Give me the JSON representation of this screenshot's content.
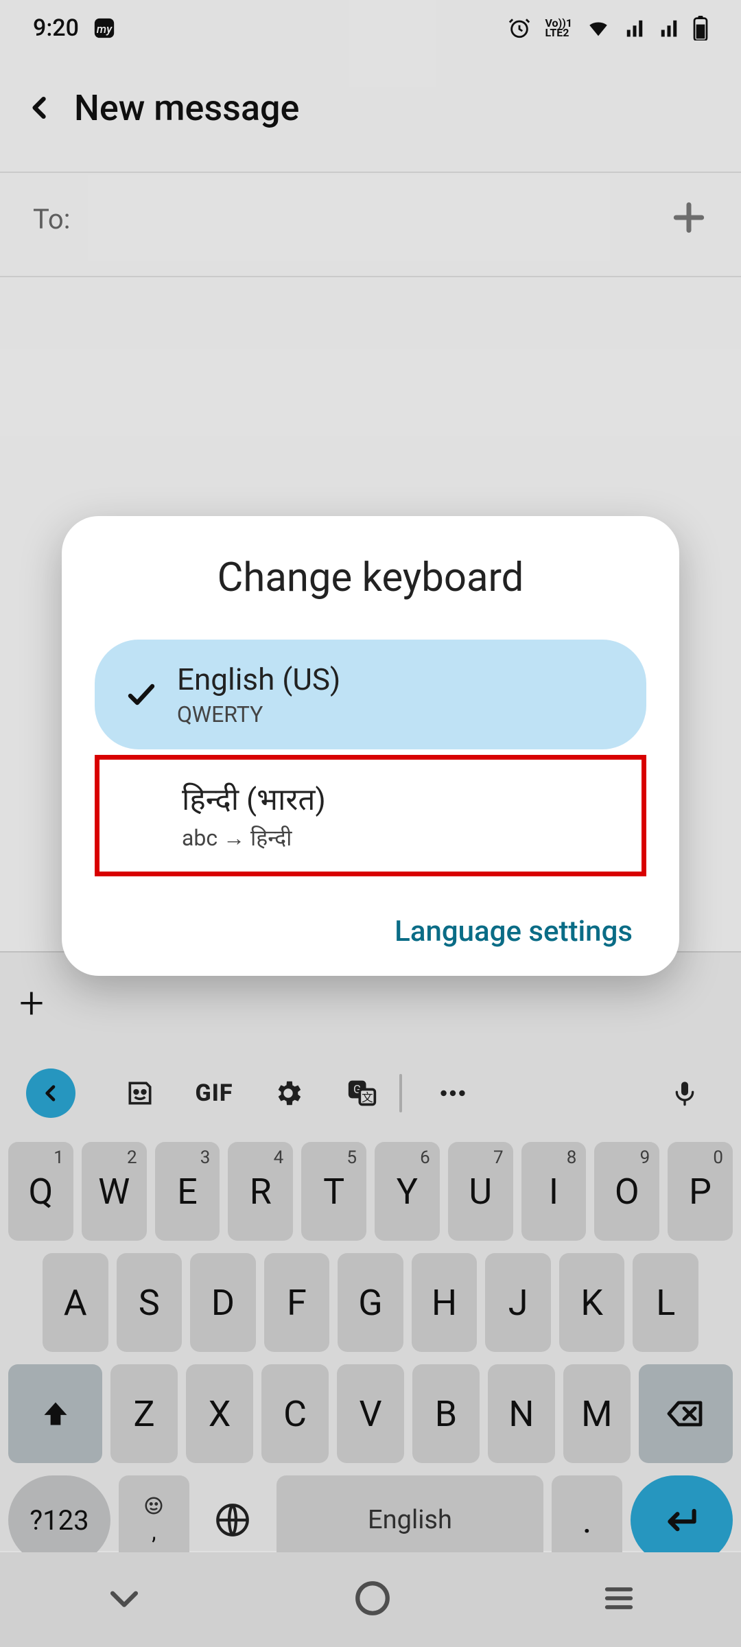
{
  "statusbar": {
    "time": "9:20"
  },
  "header": {
    "title": "New message"
  },
  "to_row": {
    "label": "To:"
  },
  "dialog": {
    "title": "Change keyboard",
    "options": [
      {
        "primary": "English (US)",
        "secondary": "QWERTY",
        "selected": true
      },
      {
        "primary": "हिन्दी (भारत)",
        "secondary": "abc → हिन्दी",
        "selected": false
      }
    ],
    "settings_label": "Language settings"
  },
  "keyboard": {
    "toolbar": {
      "gif_label": "GIF"
    },
    "row1": [
      {
        "main": "Q",
        "sup": "1"
      },
      {
        "main": "W",
        "sup": "2"
      },
      {
        "main": "E",
        "sup": "3"
      },
      {
        "main": "R",
        "sup": "4"
      },
      {
        "main": "T",
        "sup": "5"
      },
      {
        "main": "Y",
        "sup": "6"
      },
      {
        "main": "U",
        "sup": "7"
      },
      {
        "main": "I",
        "sup": "8"
      },
      {
        "main": "O",
        "sup": "9"
      },
      {
        "main": "P",
        "sup": "0"
      }
    ],
    "row2": [
      {
        "main": "A"
      },
      {
        "main": "S"
      },
      {
        "main": "D"
      },
      {
        "main": "F"
      },
      {
        "main": "G"
      },
      {
        "main": "H"
      },
      {
        "main": "J"
      },
      {
        "main": "K"
      },
      {
        "main": "L"
      }
    ],
    "row3": [
      {
        "main": "Z"
      },
      {
        "main": "X"
      },
      {
        "main": "C"
      },
      {
        "main": "V"
      },
      {
        "main": "B"
      },
      {
        "main": "N"
      },
      {
        "main": "M"
      }
    ],
    "symbol_key": "?123",
    "emoji_sub": ",",
    "space_label": "English",
    "period_key": "."
  }
}
